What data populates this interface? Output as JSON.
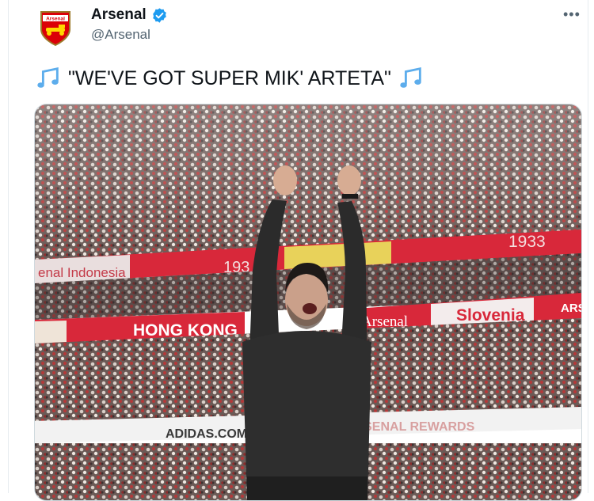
{
  "tweet": {
    "display_name": "Arsenal",
    "handle": "@Arsenal",
    "avatar_text": "Arsenal",
    "text": "\"WE'VE GOT SUPER MIK' ARTETA\"",
    "more_label": "•••"
  },
  "media": {
    "board_left": "enal Indonesia",
    "year_right": "1933",
    "year_left": "193",
    "hong_kong": "HONG KONG",
    "arsenal_board": "Arsenal",
    "slovenia": "Slovenia",
    "ars_right": "ARS",
    "adidas": "ADIDAS.COM",
    "rewards": "ARSENAL REWARDS"
  },
  "colors": {
    "verified": "#1d9bf0",
    "arsenal_red": "#db0007",
    "text": "#0f1419",
    "muted": "#536471"
  }
}
